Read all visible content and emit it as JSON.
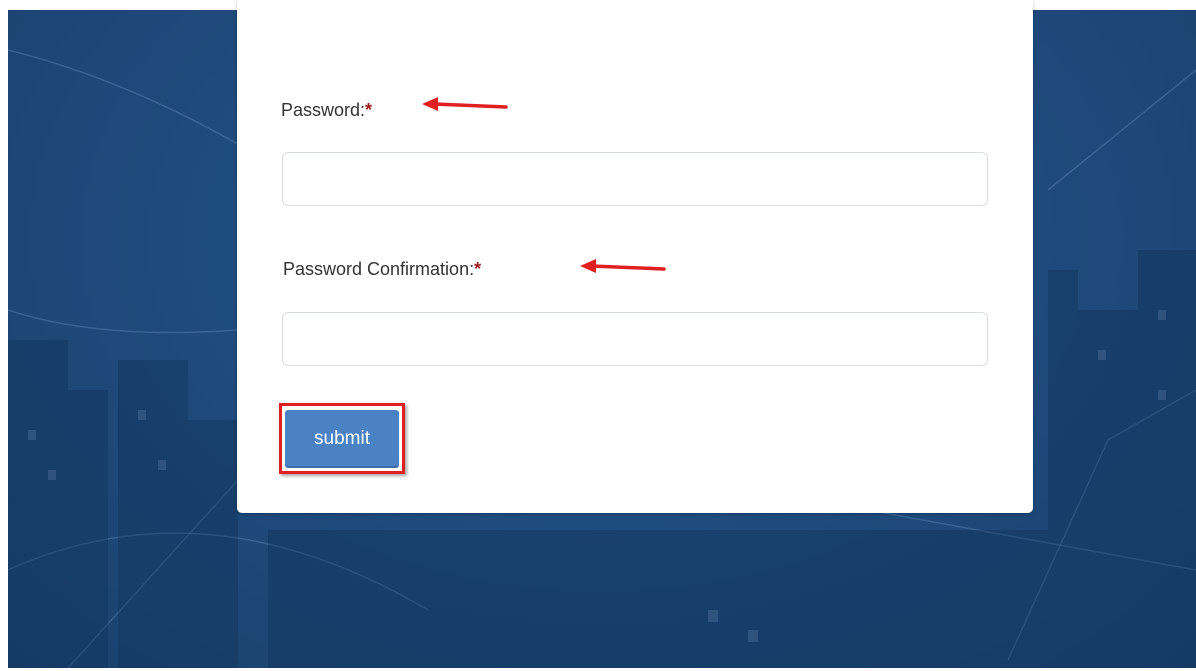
{
  "form": {
    "password": {
      "label": "Password:",
      "required_mark": "*",
      "value": "",
      "placeholder": ""
    },
    "password_confirmation": {
      "label": "Password Confirmation:",
      "required_mark": "*",
      "value": "",
      "placeholder": ""
    },
    "submit_label": "submit"
  },
  "annotations": {
    "arrow_color": "#e02020",
    "highlight_color": "#e02020"
  },
  "colors": {
    "background": "#1f4c7e",
    "button": "#4a82c4",
    "required_mark": "#a01c1c"
  }
}
